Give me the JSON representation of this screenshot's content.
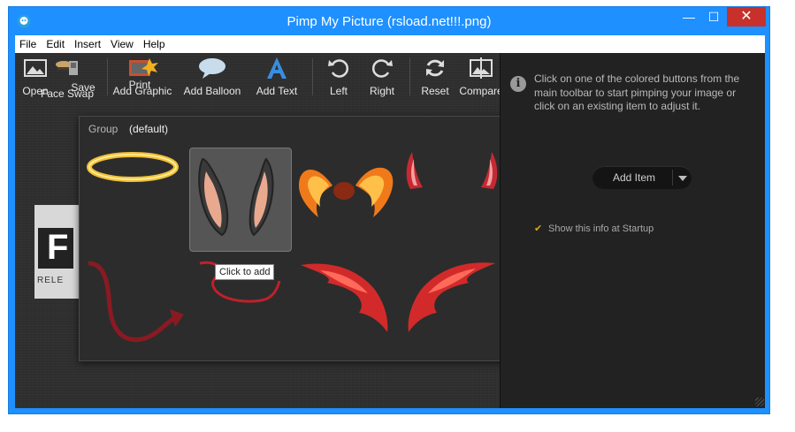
{
  "window": {
    "title": "Pimp My Picture (rsload.net!!!.png)",
    "min": "—",
    "max": "☐",
    "close": "✕"
  },
  "menu": [
    "File",
    "Edit",
    "Insert",
    "View",
    "Help"
  ],
  "toolbar": {
    "open": "Open",
    "face_swap": "Face Swap",
    "save": "Save",
    "print": "Print",
    "add_graphic": "Add Graphic",
    "add_balloon": "Add Balloon",
    "add_text": "Add Text",
    "left": "Left",
    "right": "Right",
    "reset": "Reset",
    "compare": "Compare"
  },
  "popup": {
    "group_label": "Group",
    "group_value": "(default)",
    "tooltip": "Click to add",
    "items": [
      "halo",
      "bunny-ears",
      "flame-wings",
      "devil-horns",
      "devil-tail",
      "devil-tail-thin",
      "devil-wings"
    ]
  },
  "info": {
    "text": "Click on one of the colored buttons from the main toolbar to start pimping your image or click on an existing item to adjust it.",
    "add_item": "Add Item",
    "startup": "Show this info at Startup",
    "startup_checked": true
  },
  "bg_image": {
    "letter": "F",
    "caption": "RELE"
  },
  "colors": {
    "accent": "#e0a020",
    "titlebar": "#1e90ff",
    "close": "#c7302b",
    "panel": "#222222"
  }
}
